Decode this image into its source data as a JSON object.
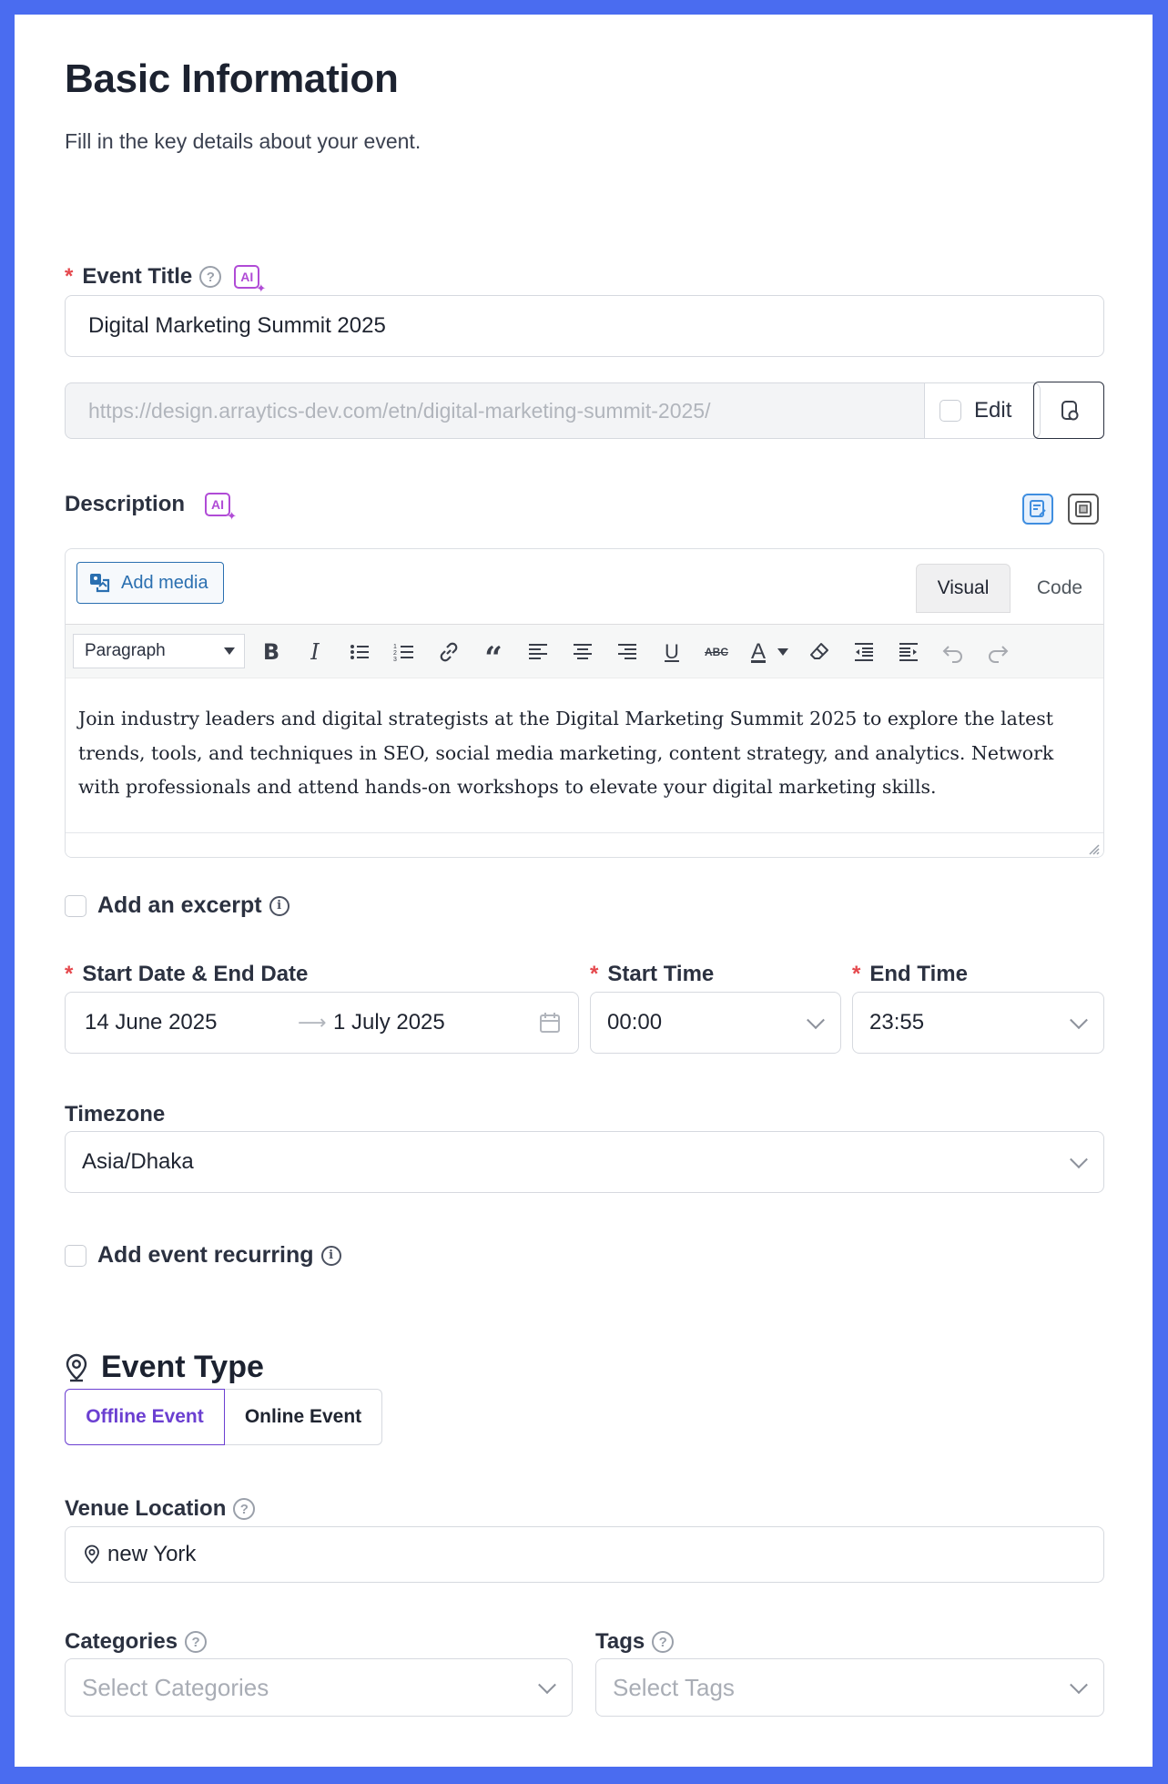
{
  "header": {
    "title": "Basic Information",
    "subtitle": "Fill in the key details about your event."
  },
  "event_title": {
    "label": "Event Title",
    "value": "Digital Marketing Summit 2025",
    "ai_badge": "AI"
  },
  "permalink": {
    "url": "https://design.arraytics-dev.com/etn/digital-marketing-summit-2025/",
    "edit_label": "Edit"
  },
  "description": {
    "label": "Description",
    "ai_badge": "AI",
    "add_media_label": "Add media",
    "tab_visual": "Visual",
    "tab_code": "Code",
    "format_select": "Paragraph",
    "content": "Join industry leaders and digital strategists at the Digital Marketing Summit 2025 to explore the latest trends, tools, and techniques in SEO, social media marketing, content strategy, and analytics. Network with professionals and attend hands-on workshops to elevate your digital marketing skills.",
    "toolbar_icons": [
      "bold-icon",
      "italic-icon",
      "bullet-list-icon",
      "numbered-list-icon",
      "link-icon",
      "blockquote-icon",
      "align-left-icon",
      "align-center-icon",
      "align-right-icon",
      "underline-icon",
      "strikethrough-icon",
      "text-color-icon",
      "clear-format-icon",
      "outdent-icon",
      "indent-icon",
      "undo-icon",
      "redo-icon"
    ]
  },
  "excerpt": {
    "label": "Add an excerpt"
  },
  "dates": {
    "label": "Start Date & End Date",
    "start_date": "14 June 2025",
    "end_date": "1 July 2025",
    "start_time_label": "Start Time",
    "start_time": "00:00",
    "end_time_label": "End Time",
    "end_time": "23:55"
  },
  "timezone": {
    "label": "Timezone",
    "value": "Asia/Dhaka"
  },
  "recurring": {
    "label": "Add event recurring"
  },
  "event_type": {
    "title": "Event Type",
    "options": [
      "Offline Event",
      "Online Event"
    ],
    "selected": "Offline Event"
  },
  "venue": {
    "label": "Venue Location",
    "value": "new York"
  },
  "categories": {
    "label": "Categories",
    "placeholder": "Select Categories"
  },
  "tags": {
    "label": "Tags",
    "placeholder": "Select Tags"
  },
  "colors": {
    "accent": "#6b3fd1",
    "required": "#e5484d",
    "ai": "#b04bd6",
    "link_blue": "#2a6fb0",
    "background": "#4a6cf0"
  }
}
